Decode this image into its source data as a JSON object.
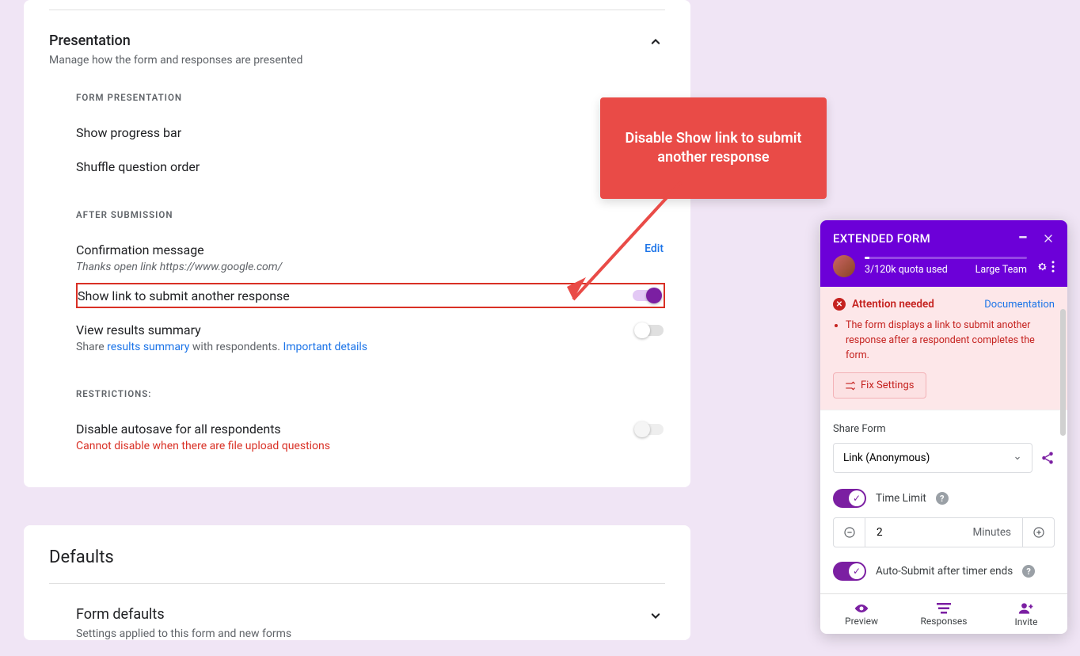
{
  "presentation": {
    "title": "Presentation",
    "subtitle": "Manage how the form and responses are presented",
    "form_presentation_heading": "FORM PRESENTATION",
    "show_progress_bar": "Show progress bar",
    "shuffle_question_order": "Shuffle question order",
    "after_submission_heading": "AFTER SUBMISSION",
    "confirmation_message": "Confirmation message",
    "confirmation_text": "Thanks open link https://www.google.com/",
    "edit_label": "Edit",
    "show_link_submit": "Show link to submit another response",
    "view_results_summary": "View results summary",
    "share_prefix": "Share ",
    "results_summary_link": "results summary",
    "with_respondents": " with respondents. ",
    "important_details": "Important details",
    "restrictions_heading": "RESTRICTIONS:",
    "disable_autosave": "Disable autosave for all respondents",
    "disable_autosave_error": "Cannot disable when there are file upload questions"
  },
  "defaults": {
    "title": "Defaults",
    "form_defaults": "Form defaults",
    "form_defaults_sub": "Settings applied to this form and new forms"
  },
  "callout": {
    "text": "Disable Show link to submit another response"
  },
  "panel": {
    "title": "EXTENDED FORM",
    "quota": "3/120k quota used",
    "plan": "Large Team",
    "alert_title": "Attention needed",
    "doc_link": "Documentation",
    "alert_text": "The form displays a link to submit another response after a respondent completes the form.",
    "fix_btn": "Fix Settings",
    "share_form": "Share Form",
    "link_anon": "Link (Anonymous)",
    "time_limit": "Time Limit",
    "time_value": "2",
    "time_unit": "Minutes",
    "auto_submit": "Auto-Submit after timer ends",
    "footer": {
      "preview": "Preview",
      "responses": "Responses",
      "invite": "Invite"
    }
  }
}
